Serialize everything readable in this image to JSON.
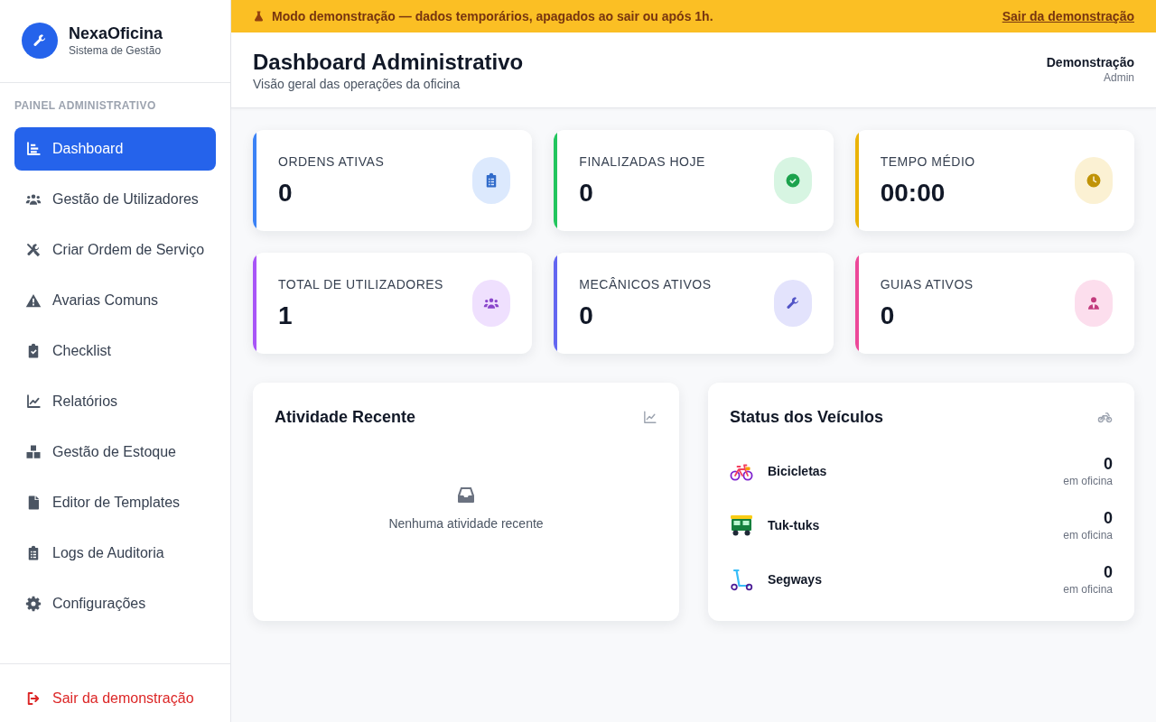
{
  "sidebar": {
    "brand": {
      "name": "NexaOficina",
      "subtitle": "Sistema de Gestão"
    },
    "section_label": "PAINEL ADMINISTRATIVO",
    "items": [
      {
        "label": "Dashboard",
        "selected": true
      },
      {
        "label": "Gestão de Utilizadores",
        "selected": false
      },
      {
        "label": "Criar Ordem de Serviço",
        "selected": false
      },
      {
        "label": "Avarias Comuns",
        "selected": false
      },
      {
        "label": "Checklist",
        "selected": false
      },
      {
        "label": "Relatórios",
        "selected": false
      },
      {
        "label": "Gestão de Estoque",
        "selected": false
      },
      {
        "label": "Editor de Templates",
        "selected": false
      },
      {
        "label": "Logs de Auditoria",
        "selected": false
      },
      {
        "label": "Configurações",
        "selected": false
      }
    ],
    "footer_link": "Sair da demonstração"
  },
  "banner": {
    "message": "Modo demonstração — dados temporários, apagados ao sair ou após 1h.",
    "link": "Sair da demonstração"
  },
  "header": {
    "title": "Dashboard Administrativo",
    "subtitle": "Visão geral das operações da oficina",
    "user": {
      "name": "Demonstração",
      "role": "Admin"
    }
  },
  "stats": [
    {
      "label": "ORDENS ATIVAS",
      "value": "0",
      "color": "#3b82f6"
    },
    {
      "label": "FINALIZADAS HOJE",
      "value": "0",
      "color": "#22c55e"
    },
    {
      "label": "TEMPO MÉDIO",
      "value": "00:00",
      "color": "#eab308"
    },
    {
      "label": "TOTAL DE UTILIZADORES",
      "value": "1",
      "color": "#a855f7"
    },
    {
      "label": "MECÂNICOS ATIVOS",
      "value": "0",
      "color": "#6366f1"
    },
    {
      "label": "GUIAS ATIVOS",
      "value": "0",
      "color": "#ec4899"
    }
  ],
  "recent_activity": {
    "title": "Atividade Recente",
    "empty_message": "Nenhuma atividade recente"
  },
  "vehicle_status": {
    "title": "Status dos Veículos",
    "rows": [
      {
        "name": "Bicicletas",
        "count": "0",
        "caption": "em oficina"
      },
      {
        "name": "Tuk-tuks",
        "count": "0",
        "caption": "em oficina"
      },
      {
        "name": "Segways",
        "count": "0",
        "caption": "em oficina"
      }
    ]
  }
}
